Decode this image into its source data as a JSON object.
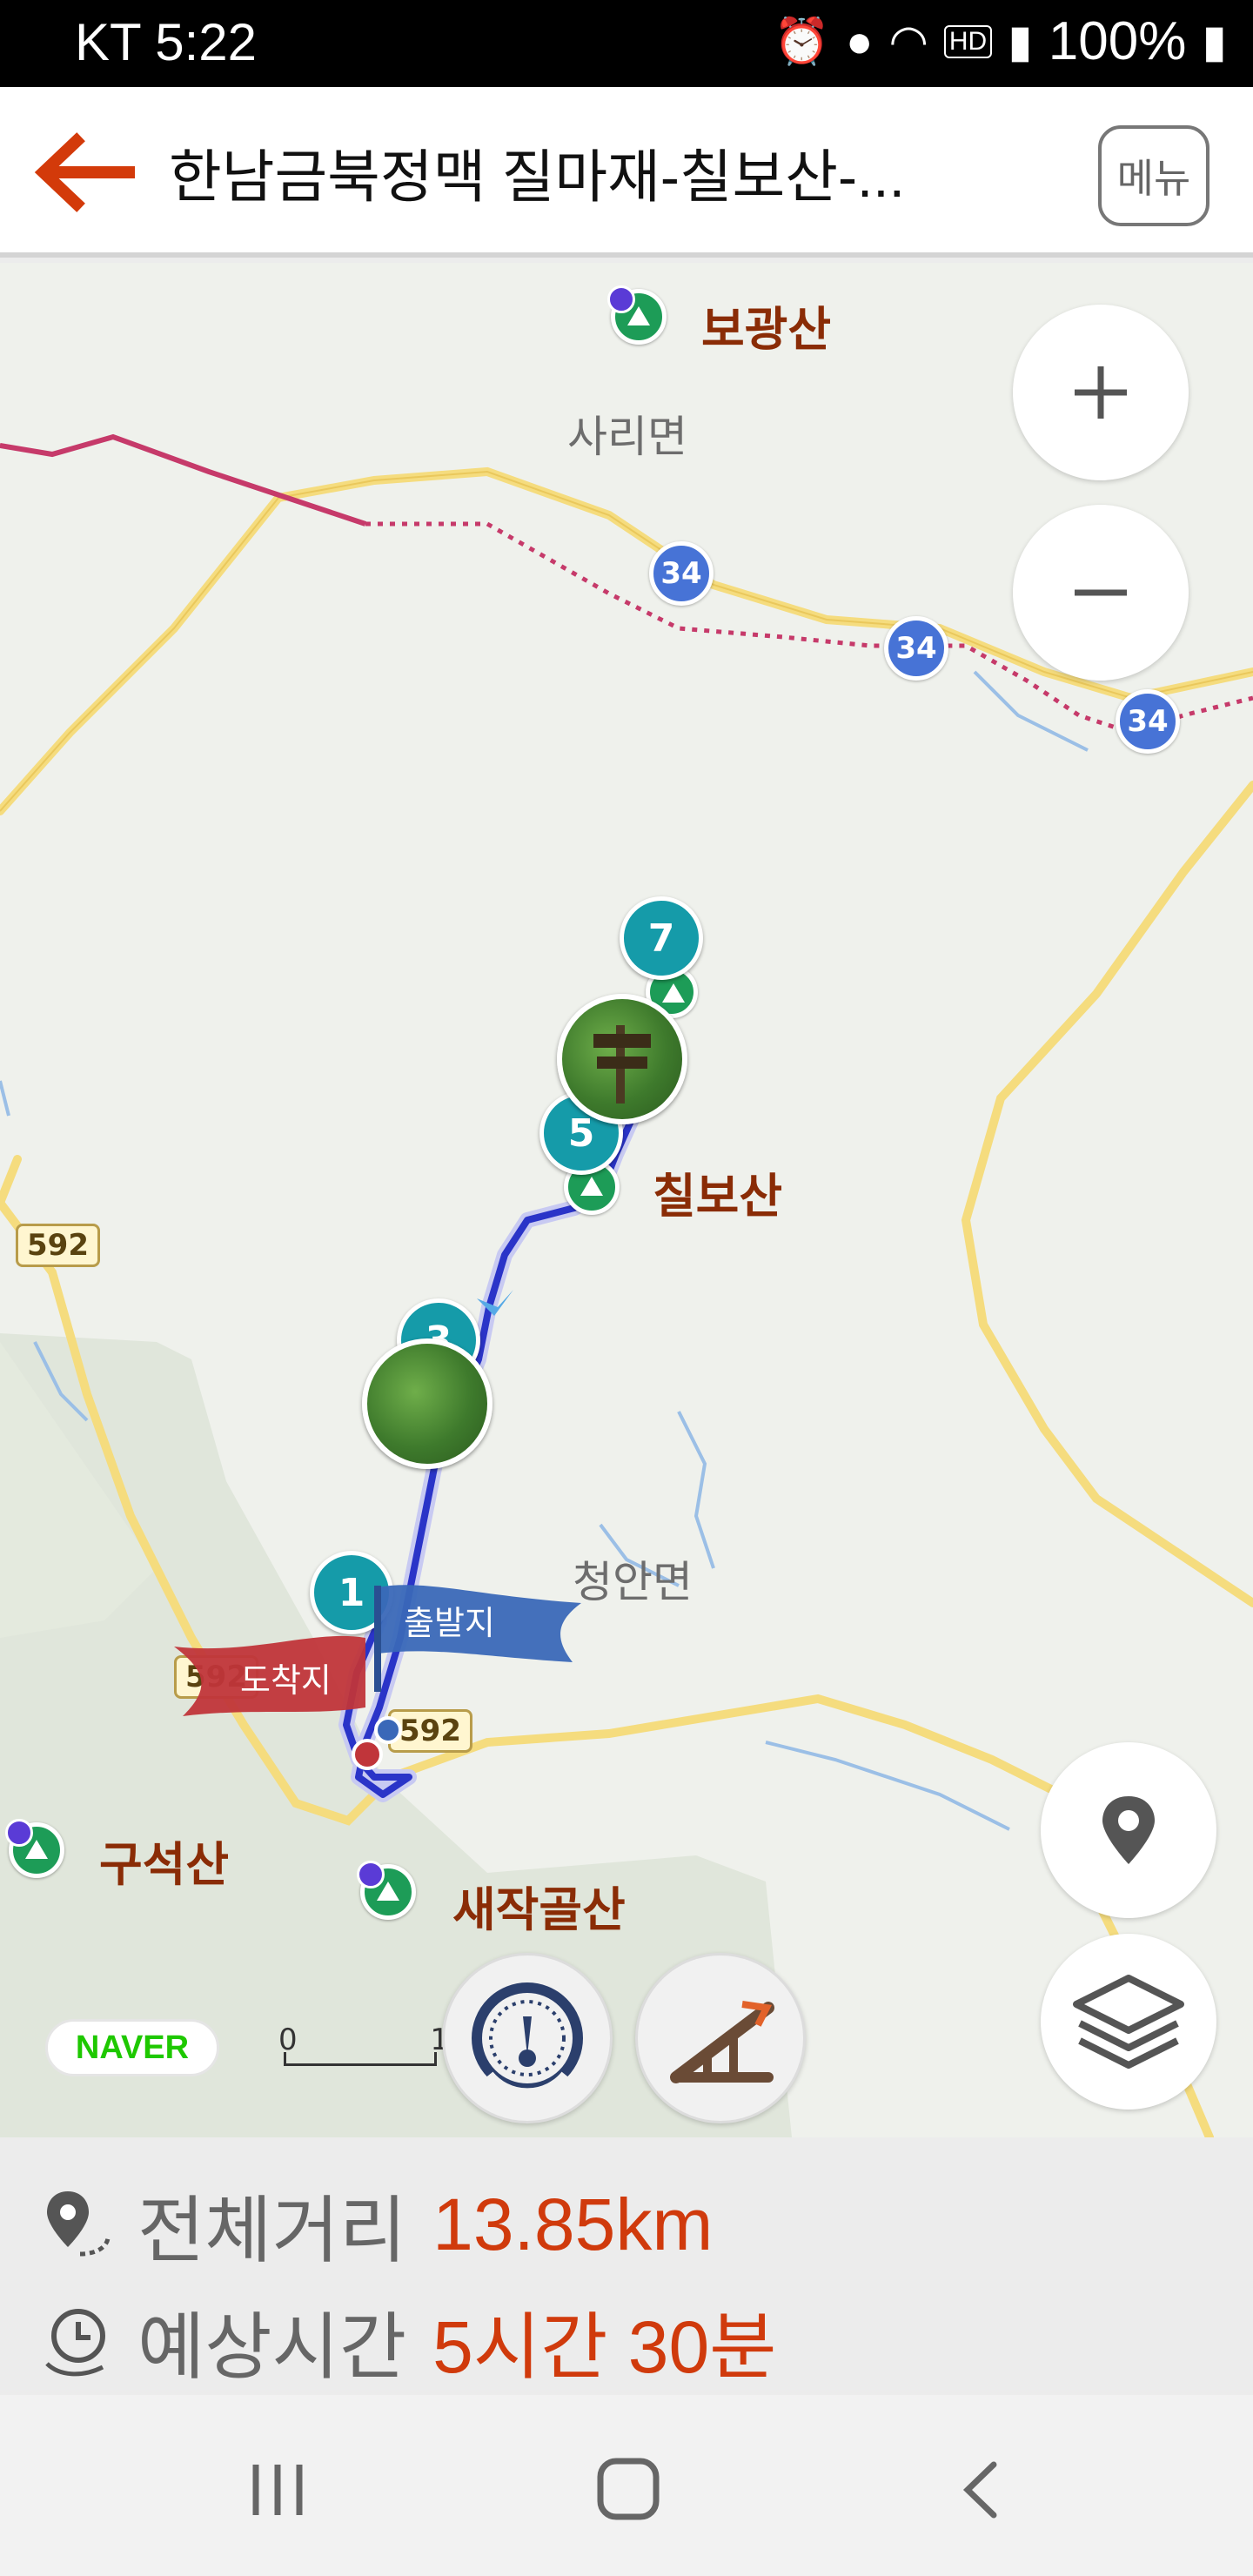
{
  "status_bar": {
    "carrier_time": "KT 5:22",
    "battery": "100%",
    "icons": [
      "alarm-icon",
      "location-icon",
      "wifi-icon",
      "hd-icon",
      "signal-icon",
      "battery-icon"
    ]
  },
  "header": {
    "title": "한남금북정맥 질마재-칠보산-...",
    "menu_label": "메뉴"
  },
  "map": {
    "place_labels": {
      "bogwangsan": "보광산",
      "sarimyeon": "사리면",
      "chilbosan": "칠보산",
      "cheongganmyeon": "청안면",
      "guseoksan": "구석산",
      "saejakgolsan": "새작골산"
    },
    "route_shields": [
      "34",
      "34",
      "34"
    ],
    "road_numbers": [
      "592",
      "592",
      "592"
    ],
    "waypoints": [
      "7",
      "5",
      "3",
      "1"
    ],
    "flags": {
      "arrival": "도착지",
      "departure": "출발지"
    },
    "scale": {
      "start": "0",
      "end": "1"
    },
    "provider": "NAVER"
  },
  "summary": {
    "distance_label": "전체거리",
    "distance_value": "13.85km",
    "time_label": "예상시간",
    "time_value": "5시간 30분"
  },
  "colors": {
    "accent": "#d03a0c",
    "route": "#2a34c8",
    "waypoint": "#159ba9",
    "departure_flag": "#3a68b8",
    "arrival_flag": "#c0353a"
  }
}
